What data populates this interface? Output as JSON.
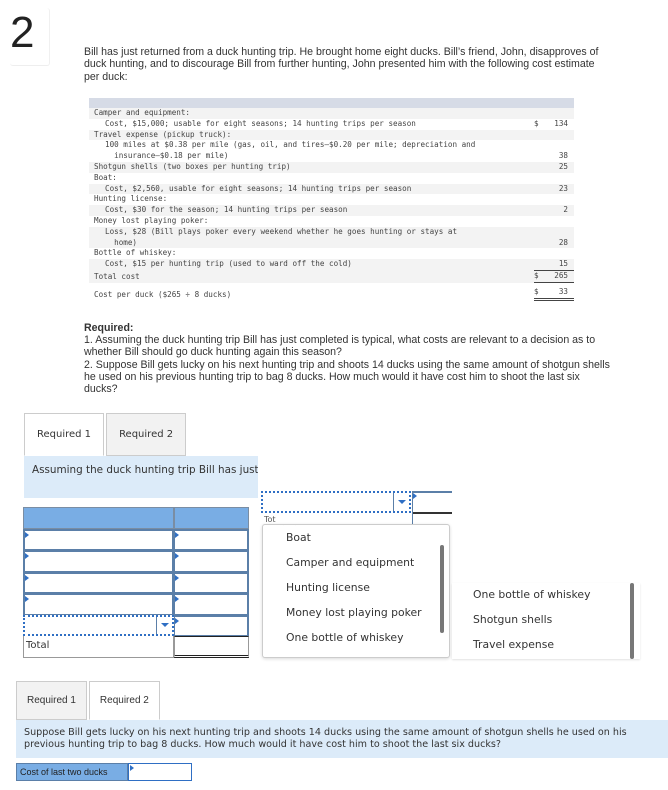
{
  "question_number": "2",
  "intro": "Bill has just returned from a duck hunting trip. He brought home eight ducks. Bill’s friend, John, disapproves of duck hunting, and to discourage Bill from further hunting, John presented him with the following cost estimate per duck:",
  "cost_table": {
    "rows": [
      {
        "text": "Camper and equipment:",
        "indent": 0,
        "currency": "",
        "amount": ""
      },
      {
        "text": "Cost, $15,000; usable for eight seasons; 14 hunting trips per season",
        "indent": 1,
        "currency": "$",
        "amount": "134"
      },
      {
        "text": "Travel expense (pickup truck):",
        "indent": 0,
        "currency": "",
        "amount": ""
      },
      {
        "text": "100 miles at $0.38 per mile (gas, oil, and tires–$0.20 per mile; depreciation and\n  insurance–$0.18 per mile)",
        "indent": 1,
        "currency": "",
        "amount": "38"
      },
      {
        "text": "Shotgun shells (two boxes per hunting trip)",
        "indent": 0,
        "currency": "",
        "amount": "25"
      },
      {
        "text": "Boat:",
        "indent": 0,
        "currency": "",
        "amount": ""
      },
      {
        "text": "Cost, $2,560, usable for eight seasons; 14 hunting trips per season",
        "indent": 1,
        "currency": "",
        "amount": "23"
      },
      {
        "text": "Hunting license:",
        "indent": 0,
        "currency": "",
        "amount": ""
      },
      {
        "text": "Cost, $30 for the season; 14 hunting trips per season",
        "indent": 1,
        "currency": "",
        "amount": "2"
      },
      {
        "text": "Money lost playing poker:",
        "indent": 0,
        "currency": "",
        "amount": ""
      },
      {
        "text": "Loss, $28 (Bill plays poker every weekend whether he goes hunting or stays at\n  home)",
        "indent": 1,
        "currency": "",
        "amount": "28"
      },
      {
        "text": "Bottle of whiskey:",
        "indent": 0,
        "currency": "",
        "amount": ""
      },
      {
        "text": "Cost, $15 per hunting trip (used to ward off the cold)",
        "indent": 1,
        "currency": "",
        "amount": "15"
      }
    ],
    "total": {
      "text": "Total cost",
      "currency": "$",
      "amount": "265"
    },
    "per_duck": {
      "text": "Cost per duck ($265 ÷ 8 ducks)",
      "currency": "$",
      "amount": "33"
    }
  },
  "required": {
    "label": "Required:",
    "items": [
      "1.  Assuming the duck hunting trip Bill has just completed is typical, what costs are relevant to a decision as to whether Bill should go duck hunting again this season?",
      "2. Suppose Bill gets lucky on his next hunting trip and shoots 14 ducks using the same amount of shotgun shells he used on his previous hunting trip to bag 8 ducks. How much would it have cost him to shoot the last six ducks?"
    ]
  },
  "part1": {
    "tabs": [
      {
        "label": "Required 1",
        "active": true
      },
      {
        "label": "Required 2",
        "active": false
      }
    ],
    "prompt": "Assuming the duck hunting trip Bill has just completed is typical, what costs are relevant to a decision as to whether Bill should go duck hunting again this season?",
    "answer_rows": [
      {
        "item": "",
        "amount": ""
      },
      {
        "item": "",
        "amount": ""
      },
      {
        "item": "",
        "amount": ""
      },
      {
        "item": "",
        "amount": ""
      },
      {
        "item": "",
        "amount": ""
      }
    ],
    "total_label": "Total",
    "total_value": "",
    "dropdown_partial_text": "Tot",
    "dropdown_options": [
      "Boat",
      "Camper and equipment",
      "Hunting license",
      "Money lost playing poker",
      "One bottle of whiskey",
      "Shotgun shells"
    ],
    "dropdown_options_scrolled": [
      "One bottle of whiskey",
      "Shotgun shells",
      "Travel expense"
    ]
  },
  "part2": {
    "tabs": [
      {
        "label": "Required 1",
        "active": false
      },
      {
        "label": "Required 2",
        "active": true
      }
    ],
    "prompt": "Suppose Bill gets lucky on his next hunting trip and shoots 14 ducks using the same amount of shotgun shells he used on his previous hunting trip to bag 8 ducks. How much would it have cost him to shoot the last six ducks?",
    "input_label": "Cost of last two ducks",
    "input_value": ""
  }
}
